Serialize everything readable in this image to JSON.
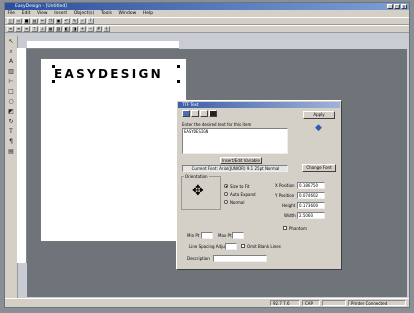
{
  "window": {
    "title": "EasyDesign - [Untitled]"
  },
  "menu": [
    "File",
    "Edit",
    "View",
    "Insert",
    "Object(s)",
    "Tools",
    "Window",
    "Help"
  ],
  "canvas": {
    "label_text": "EASYDESIGN"
  },
  "dialog": {
    "title": "TTF Text",
    "apply_label": "Apply",
    "prompt": "Enter the desired text for this item",
    "text_value": "EASYDESIGN",
    "insert_variable_label": "Insert/Edit Variable",
    "font_info": "Current Font: Arial(JUNIOR) 9.1 25pt Normal",
    "change_font_label": "Change Font",
    "orientation_label": "Orientation",
    "radio_size_to_fit": "Size to Fit",
    "radio_auto_expand": "Auto Expand",
    "radio_normal": "Normal",
    "x_label": "X Position",
    "x_value": "0.186750",
    "y_label": "Y Position",
    "y_value": "0.074602",
    "h_label": "Height",
    "h_value": "0.173600",
    "w_label": "Width",
    "w_value": "2.5060",
    "phantom_label": "Phantom",
    "min_pt_label": "Min Pt",
    "max_pt_label": "Max Pt",
    "line_spacing_label": "Line Spacing Adjust",
    "omit_blank_label": "Omit Blank Lines",
    "description_label": "Description"
  },
  "status": {
    "coords": "92.7 7.6",
    "cap": "CAP",
    "mode": "Printer Connected"
  }
}
